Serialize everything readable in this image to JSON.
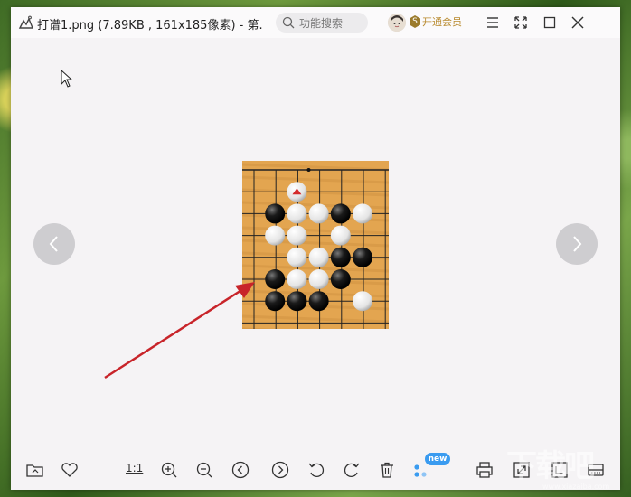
{
  "window": {
    "title": "打谱1.png (7.89KB , 161x185像素) - 第..."
  },
  "search": {
    "placeholder": "功能搜索"
  },
  "vip": {
    "icon_letter": "S",
    "label": "开通会员"
  },
  "titlebar_buttons": [
    "menu-icon",
    "fullscreen-icon",
    "maximize-icon",
    "close-icon"
  ],
  "toolbar": {
    "one_to_one_label": "1:1",
    "new_badge": "new",
    "items": [
      "open-folder-icon",
      "favorite-heart-icon",
      "actual-size",
      "zoom-in-icon",
      "zoom-out-icon",
      "previous-icon",
      "next-icon",
      "rotate-left-icon",
      "rotate-right-icon",
      "delete-icon",
      "more-apps-icon",
      "print-icon",
      "fit-window-icon",
      "crop-icon",
      "scan-icon"
    ]
  },
  "watermark": {
    "text": "下载吧",
    "url": "www.xiazaiba.com"
  },
  "go_board": {
    "stones": [
      {
        "col": 2,
        "row": 1,
        "color": "white",
        "marker": "triangle"
      },
      {
        "col": 1,
        "row": 2,
        "color": "black"
      },
      {
        "col": 2,
        "row": 2,
        "color": "white"
      },
      {
        "col": 3,
        "row": 2,
        "color": "white"
      },
      {
        "col": 4,
        "row": 2,
        "color": "black"
      },
      {
        "col": 5,
        "row": 2,
        "color": "white"
      },
      {
        "col": 1,
        "row": 3,
        "color": "white"
      },
      {
        "col": 2,
        "row": 3,
        "color": "white"
      },
      {
        "col": 4,
        "row": 3,
        "color": "white"
      },
      {
        "col": 2,
        "row": 4,
        "color": "white"
      },
      {
        "col": 3,
        "row": 4,
        "color": "white"
      },
      {
        "col": 4,
        "row": 4,
        "color": "black"
      },
      {
        "col": 5,
        "row": 4,
        "color": "black"
      },
      {
        "col": 1,
        "row": 5,
        "color": "black"
      },
      {
        "col": 2,
        "row": 5,
        "color": "white"
      },
      {
        "col": 3,
        "row": 5,
        "color": "white"
      },
      {
        "col": 4,
        "row": 5,
        "color": "black"
      },
      {
        "col": 1,
        "row": 6,
        "color": "black"
      },
      {
        "col": 2,
        "row": 6,
        "color": "black"
      },
      {
        "col": 3,
        "row": 6,
        "color": "black"
      },
      {
        "col": 5,
        "row": 6,
        "color": "white"
      }
    ]
  },
  "colors": {
    "board_wood": "#e3a550",
    "arrow": "#c8242a",
    "marker": "#d42b2b"
  }
}
